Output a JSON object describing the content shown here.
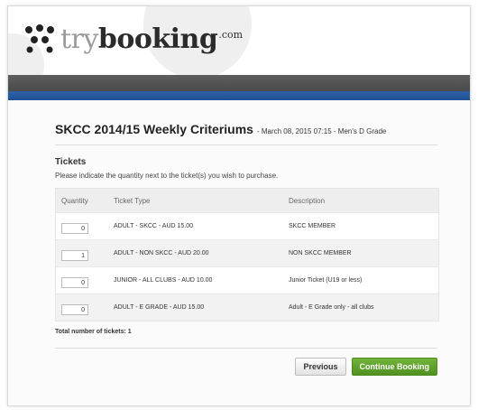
{
  "brand": {
    "logo_prefix": "try",
    "logo_main": "booking",
    "logo_suffix": ".com",
    "colors": {
      "grey_bar": "#525252",
      "blue_bar": "#2557a0",
      "green_button": "#5fa22c"
    }
  },
  "event": {
    "name": "SKCC 2014/15 Weekly Criteriums",
    "meta": "- March 08, 2015 07:15 - Men's D Grade"
  },
  "tickets": {
    "heading": "Tickets",
    "instruction": "Please indicate the quantity next to the ticket(s) you wish to purchase.",
    "columns": {
      "quantity": "Quantity",
      "ticket_type": "Ticket Type",
      "description": "Description"
    },
    "rows": [
      {
        "quantity": "0",
        "type": "ADULT - SKCC - AUD 15.00",
        "description": "SKCC MEMBER"
      },
      {
        "quantity": "1",
        "type": "ADULT - NON SKCC - AUD 20.00",
        "description": "NON SKCC MEMBER"
      },
      {
        "quantity": "0",
        "type": "JUNIOR - ALL CLUBS - AUD 10.00",
        "description": "Junior Ticket (U19 or less)"
      },
      {
        "quantity": "0",
        "type": "ADULT - E GRADE - AUD 15.00",
        "description": "Adult - E Grade only - all clubs"
      }
    ],
    "total": "Total number of tickets: 1"
  },
  "actions": {
    "previous": "Previous",
    "continue": "Continue Booking"
  }
}
